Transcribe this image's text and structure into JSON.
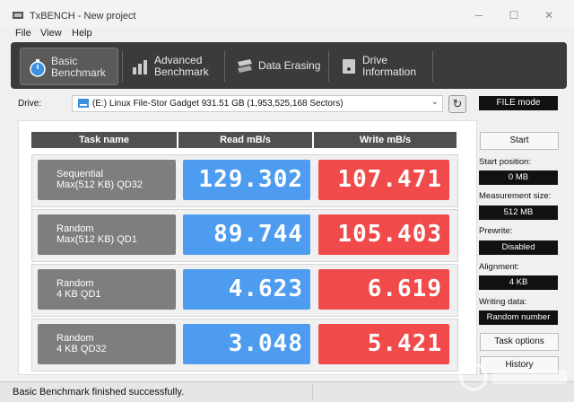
{
  "window": {
    "title": "TxBENCH - New project"
  },
  "menu": {
    "file": "File",
    "view": "View",
    "help": "Help"
  },
  "toolbar": {
    "basic": "Basic\nBenchmark",
    "advanced": "Advanced\nBenchmark",
    "erasing": "Data Erasing",
    "info": "Drive\nInformation"
  },
  "drive": {
    "label": "Drive:",
    "selected": "(E:) Linux File-Stor Gadget  931.51 GB (1,953,525,168 Sectors)"
  },
  "file_mode": "FILE mode",
  "table": {
    "headers": {
      "task": "Task name",
      "read": "Read mB/s",
      "write": "Write mB/s"
    },
    "rows": [
      {
        "task": "Sequential\nMax(512 KB) QD32",
        "read": "129.302",
        "write": "107.471"
      },
      {
        "task": "Random\nMax(512 KB) QD1",
        "read": "89.744",
        "write": "105.403"
      },
      {
        "task": "Random\n4 KB QD1",
        "read": "4.623",
        "write": "6.619"
      },
      {
        "task": "Random\n4 KB QD32",
        "read": "3.048",
        "write": "5.421"
      }
    ]
  },
  "side": {
    "start": "Start",
    "start_position_label": "Start position:",
    "start_position": "0 MB",
    "measurement_size_label": "Measurement size:",
    "measurement_size": "512 MB",
    "prewrite_label": "Prewrite:",
    "prewrite": "Disabled",
    "alignment_label": "Alignment:",
    "alignment": "4 KB",
    "writing_data_label": "Writing data:",
    "writing_data": "Random number",
    "task_options": "Task options",
    "history": "History"
  },
  "status": {
    "message": "Basic Benchmark finished successfully."
  },
  "colors": {
    "read": "#4e9cf0",
    "write": "#f04a4a",
    "toolbar": "#3b3b3b"
  }
}
